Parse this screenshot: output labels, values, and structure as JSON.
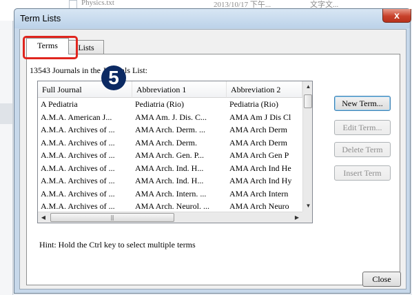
{
  "background": {
    "file_name": "Physics.txt",
    "file_date": "2013/10/17 下午...",
    "file_type": "文字文..."
  },
  "dialog": {
    "title": "Term Lists",
    "close_glyph": "x"
  },
  "tabs": [
    {
      "label": "Terms",
      "active": true
    },
    {
      "label": "Lists",
      "active": false
    }
  ],
  "count_text": "13543 Journals in the Journals List:",
  "step_badge": "5",
  "columns": [
    "Full Journal",
    "Abbreviation 1",
    "Abbreviation 2"
  ],
  "rows": [
    [
      "A Pediatria",
      "Pediatria (Rio)",
      "Pediatria (Rio)"
    ],
    [
      "A.M.A. American J...",
      "AMA Am. J. Dis. C...",
      "AMA Am J Dis Cl"
    ],
    [
      "A.M.A. Archives of ...",
      "AMA Arch. Derm. ...",
      "AMA Arch Derm"
    ],
    [
      "A.M.A. Archives of ...",
      "AMA Arch. Derm.",
      "AMA Arch Derm"
    ],
    [
      "A.M.A. Archives of ...",
      "AMA Arch. Gen. P...",
      "AMA Arch Gen P"
    ],
    [
      "A.M.A. Archives of ...",
      "AMA Arch. Ind. H...",
      "AMA Arch Ind He"
    ],
    [
      "A.M.A. Archives of ...",
      "AMA Arch. Ind. H...",
      "AMA Arch Ind Hy"
    ],
    [
      "A.M.A. Archives of ...",
      "AMA Arch. Intern. ...",
      "AMA Arch Intern"
    ],
    [
      "A.M.A. Archives of ...",
      "AMA Arch. Neurol. ...",
      "AMA Arch Neuro"
    ]
  ],
  "buttons": {
    "new_term": "New Term...",
    "edit_term": "Edit Term...",
    "delete_term": "Delete Term",
    "insert_term": "Insert Term",
    "close": "Close"
  },
  "hint": "Hint: Hold the Ctrl key to select multiple terms",
  "colors": {
    "highlight": "#e0251e",
    "badge": "#0c2a63",
    "title_close": "#c8412b"
  }
}
